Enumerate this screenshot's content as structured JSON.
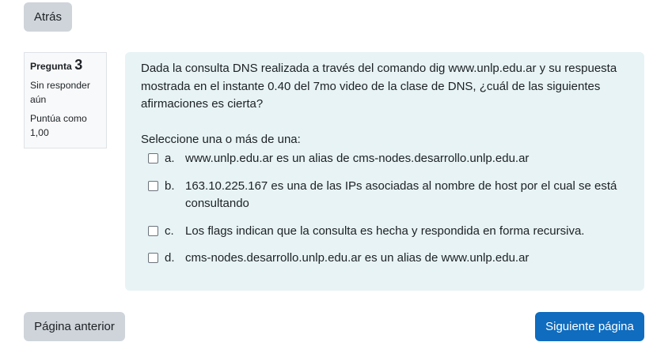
{
  "nav": {
    "back_label": "Atrás",
    "prev_label": "Página anterior",
    "next_label": "Siguiente página"
  },
  "question_info": {
    "label": "Pregunta",
    "number": "3",
    "status": "Sin responder aún",
    "grade": "Puntúa como 1,00"
  },
  "question": {
    "text": "Dada la consulta DNS realizada a través del comando dig www.unlp.edu.ar y su respuesta mostrada en el instante 0.40 del 7mo video de la clase de DNS, ¿cuál de las siguientes afirmaciones es cierta?",
    "prompt": "Seleccione una o más de una:",
    "answers": [
      {
        "letter": "a.",
        "text": "www.unlp.edu.ar es un alias de cms-nodes.desarrollo.unlp.edu.ar"
      },
      {
        "letter": "b.",
        "text": "163.10.225.167  es una de las IPs asociadas al nombre de host por el cual se está consultando"
      },
      {
        "letter": "c.",
        "text": "Los flags indican que la consulta es hecha y respondida en forma recursiva."
      },
      {
        "letter": "d.",
        "text": "cms-nodes.desarrollo.unlp.edu.ar es un alias de www.unlp.edu.ar"
      }
    ]
  },
  "colors": {
    "primary": "#0f6cbf",
    "secondary": "#ced4da",
    "content_bg": "#e7f3f5"
  }
}
